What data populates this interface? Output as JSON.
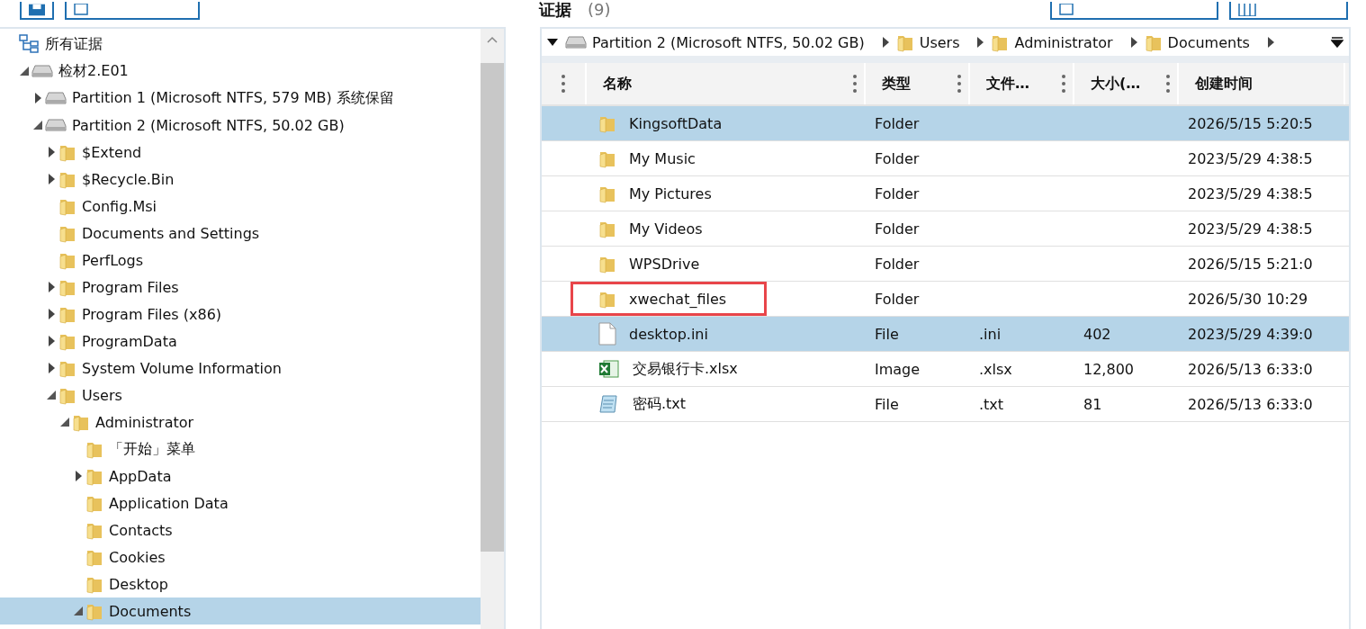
{
  "header": {
    "title": "证据",
    "count": "(9)"
  },
  "tree": [
    {
      "label": "所有证据",
      "kind": "root",
      "selected": false,
      "children": [
        {
          "label": "检材2.E01",
          "kind": "drive",
          "expanded": true,
          "selected": false,
          "children": [
            {
              "label": "Partition 1 (Microsoft NTFS, 579 MB) 系统保留",
              "kind": "drive",
              "expanded": false,
              "selected": false
            },
            {
              "label": "Partition 2 (Microsoft NTFS, 50.02 GB)",
              "kind": "drive",
              "expanded": true,
              "selected": false,
              "children": [
                {
                  "label": "$Extend",
                  "kind": "folder",
                  "expanded": false,
                  "selected": false
                },
                {
                  "label": "$Recycle.Bin",
                  "kind": "folder",
                  "expanded": false,
                  "selected": false
                },
                {
                  "label": "Config.Msi",
                  "kind": "folder",
                  "selected": false
                },
                {
                  "label": "Documents and Settings",
                  "kind": "folder",
                  "selected": false
                },
                {
                  "label": "PerfLogs",
                  "kind": "folder",
                  "selected": false
                },
                {
                  "label": "Program Files",
                  "kind": "folder",
                  "expanded": false,
                  "selected": false
                },
                {
                  "label": "Program Files (x86)",
                  "kind": "folder",
                  "expanded": false,
                  "selected": false
                },
                {
                  "label": "ProgramData",
                  "kind": "folder",
                  "expanded": false,
                  "selected": false
                },
                {
                  "label": "System Volume Information",
                  "kind": "folder",
                  "expanded": false,
                  "selected": false
                },
                {
                  "label": "Users",
                  "kind": "folder",
                  "expanded": true,
                  "selected": false,
                  "children": [
                    {
                      "label": "Administrator",
                      "kind": "folder",
                      "expanded": true,
                      "selected": false,
                      "children": [
                        {
                          "label": "「开始」菜单",
                          "kind": "folder",
                          "selected": false
                        },
                        {
                          "label": "AppData",
                          "kind": "folder",
                          "expanded": false,
                          "selected": false
                        },
                        {
                          "label": "Application Data",
                          "kind": "folder",
                          "selected": false
                        },
                        {
                          "label": "Contacts",
                          "kind": "folder",
                          "selected": false
                        },
                        {
                          "label": "Cookies",
                          "kind": "folder",
                          "selected": false
                        },
                        {
                          "label": "Desktop",
                          "kind": "folder",
                          "selected": false
                        },
                        {
                          "label": "Documents",
                          "kind": "folder",
                          "expanded": true,
                          "selected": true
                        }
                      ]
                    }
                  ]
                }
              ]
            }
          ]
        }
      ]
    }
  ],
  "breadcrumb": [
    {
      "label": "Partition 2 (Microsoft NTFS, 50.02 GB)",
      "kind": "drive"
    },
    {
      "label": "Users",
      "kind": "folder"
    },
    {
      "label": "Administrator",
      "kind": "folder"
    },
    {
      "label": "Documents",
      "kind": "folder"
    }
  ],
  "table": {
    "columns": [
      "名称",
      "类型",
      "文件…",
      "大小(…",
      "创建时间"
    ],
    "rows": [
      {
        "name": "KingsoftData",
        "kind": "folder",
        "type": "Folder",
        "ext": "",
        "size": "",
        "created": "2026/5/15 5:20:5",
        "selected": true,
        "highlighted": false
      },
      {
        "name": "My Music",
        "kind": "folder",
        "type": "Folder",
        "ext": "",
        "size": "",
        "created": "2023/5/29 4:38:5",
        "selected": false,
        "highlighted": false
      },
      {
        "name": "My Pictures",
        "kind": "folder",
        "type": "Folder",
        "ext": "",
        "size": "",
        "created": "2023/5/29 4:38:5",
        "selected": false,
        "highlighted": false
      },
      {
        "name": "My Videos",
        "kind": "folder",
        "type": "Folder",
        "ext": "",
        "size": "",
        "created": "2023/5/29 4:38:5",
        "selected": false,
        "highlighted": false
      },
      {
        "name": "WPSDrive",
        "kind": "folder",
        "type": "Folder",
        "ext": "",
        "size": "",
        "created": "2026/5/15 5:21:0",
        "selected": false,
        "highlighted": false
      },
      {
        "name": "xwechat_files",
        "kind": "folder",
        "type": "Folder",
        "ext": "",
        "size": "",
        "created": "2026/5/30 10:29",
        "selected": false,
        "highlighted": true
      },
      {
        "name": "desktop.ini",
        "kind": "file",
        "type": "File",
        "ext": ".ini",
        "size": "402",
        "created": "2023/5/29 4:39:0",
        "selected": true,
        "highlighted": false
      },
      {
        "name": "交易银行卡.xlsx",
        "kind": "sheet",
        "type": "Image",
        "ext": ".xlsx",
        "size": "12,800",
        "created": "2026/5/13 6:33:0",
        "selected": false,
        "highlighted": false
      },
      {
        "name": "密码.txt",
        "kind": "note",
        "type": "File",
        "ext": ".txt",
        "size": "81",
        "created": "2026/5/13 6:33:0",
        "selected": false,
        "highlighted": false
      }
    ]
  }
}
